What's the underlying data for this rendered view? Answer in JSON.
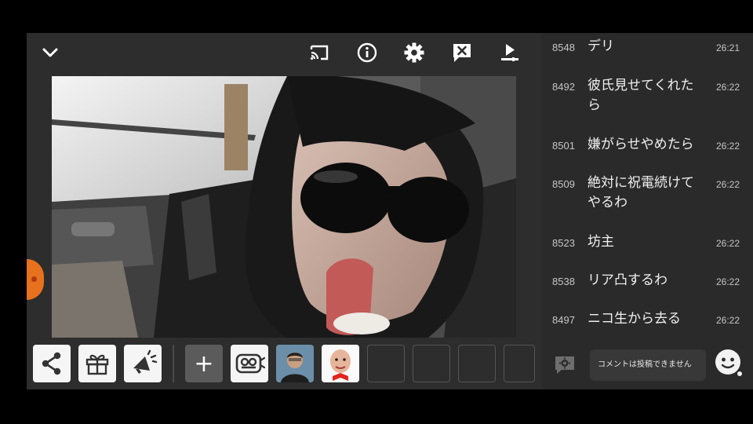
{
  "player": {
    "icons": {
      "collapse": "chevron-down-icon",
      "cast": "cast-icon",
      "info": "info-icon",
      "settings": "gear-icon",
      "close_comments": "close-comment-icon",
      "skip": "play-skip-icon"
    }
  },
  "bottom": {
    "add_label": "+",
    "tiles": [
      "share-icon",
      "gift-icon",
      "megaphone-icon",
      "add-button",
      "nicoad-icon",
      "avatar-1",
      "avatar-2",
      "empty",
      "empty",
      "empty",
      "empty"
    ]
  },
  "comments": [
    {
      "num": "8548",
      "text": "デリ",
      "time": "26:21"
    },
    {
      "num": "8492",
      "text": "彼氏見せてくれたら",
      "time": "26:22"
    },
    {
      "num": "8501",
      "text": "嫌がらせやめたら",
      "time": "26:22"
    },
    {
      "num": "8509",
      "text": "絶対に祝電続けてやるわ",
      "time": "26:22"
    },
    {
      "num": "8523",
      "text": "坊主",
      "time": "26:22"
    },
    {
      "num": "8538",
      "text": "リア凸するわ",
      "time": "26:22"
    },
    {
      "num": "8497",
      "text": "ニコ生から去る",
      "time": "26:22"
    }
  ],
  "compose": {
    "placeholder": "コメントは投稿できません"
  },
  "colors": {
    "background": "#2a2a2a",
    "accent": "#e8711e"
  }
}
